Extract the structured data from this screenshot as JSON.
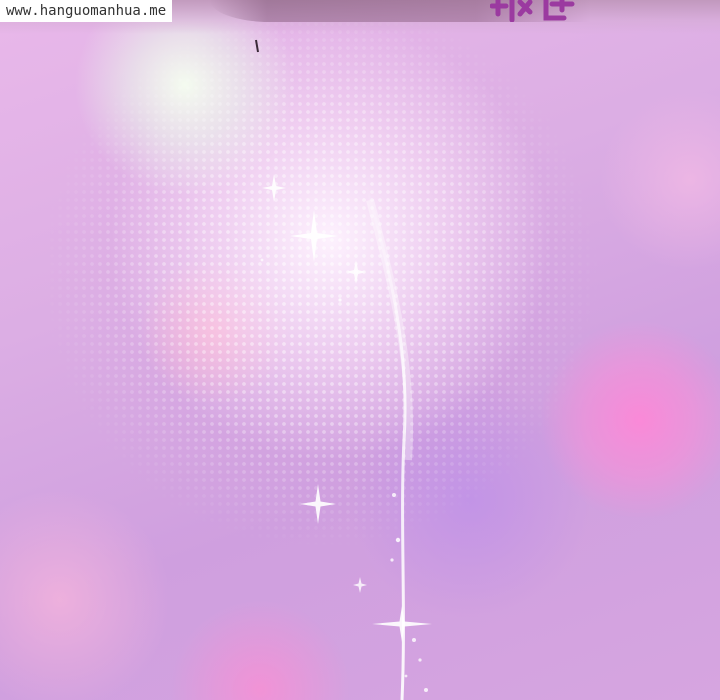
{
  "watermark": {
    "text": "www.hanguomanhua.me"
  },
  "palette": {
    "base": "#d9a6e0",
    "bokeh_pink": "#ff87d7",
    "bokeh_white": "#f5fff0",
    "sfx_purple": "#9b3aa0"
  },
  "icons": {
    "sparkle": "sparkle-icon",
    "sfx": "sound-effect-lettering"
  }
}
